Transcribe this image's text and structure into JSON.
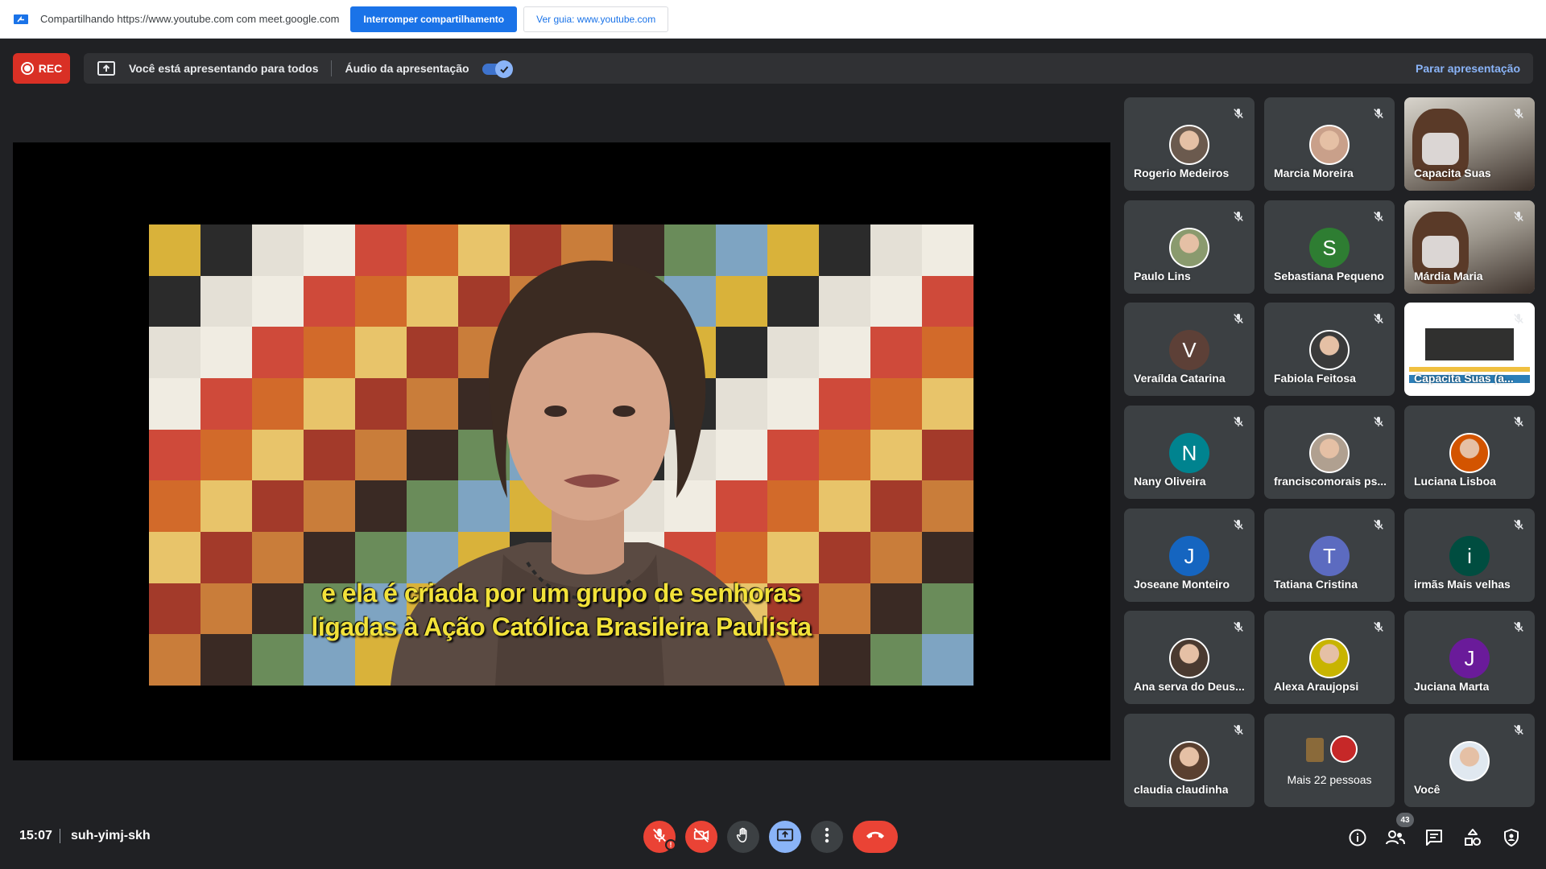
{
  "share_bar": {
    "text": "Compartilhando https://www.youtube.com com meet.google.com",
    "stop_label": "Interromper compartilhamento",
    "view_label": "Ver guia: www.youtube.com"
  },
  "rec": {
    "label": "REC"
  },
  "presenting": {
    "status": "Você está apresentando para todos",
    "audio_label": "Áudio da apresentação",
    "audio_enabled": true,
    "stop_label": "Parar apresentação"
  },
  "video": {
    "caption_line1": "e ela é criada por um grupo de senhoras",
    "caption_line2": "ligadas à Ação Católica Brasileira Paulista"
  },
  "participants": [
    {
      "name": "Rogerio Medeiros",
      "type": "photo",
      "color": "#6b5a4e"
    },
    {
      "name": "Marcia Moreira",
      "type": "photo",
      "color": "#c9a08a"
    },
    {
      "name": "Capacita Suas",
      "type": "video"
    },
    {
      "name": "Paulo Lins",
      "type": "photo",
      "color": "#8a9a6e"
    },
    {
      "name": "Sebastiana Pequeno",
      "type": "initial",
      "initial": "S",
      "color": "#2e7d32"
    },
    {
      "name": "Márdia Maria",
      "type": "video"
    },
    {
      "name": "Veraílda Catarina",
      "type": "initial",
      "initial": "V",
      "color": "#5d4037"
    },
    {
      "name": "Fabiola Feitosa",
      "type": "photo",
      "color": "#3a3a3a"
    },
    {
      "name": "Capacita Suas (a...",
      "type": "screen"
    },
    {
      "name": "Nany Oliveira",
      "type": "initial",
      "initial": "N",
      "color": "#00838f"
    },
    {
      "name": "franciscomorais ps...",
      "type": "photo",
      "color": "#b0a090"
    },
    {
      "name": "Luciana Lisboa",
      "type": "photo",
      "color": "#d35400"
    },
    {
      "name": "Joseane Monteiro",
      "type": "initial",
      "initial": "J",
      "color": "#1565c0"
    },
    {
      "name": "Tatiana Cristina",
      "type": "initial",
      "initial": "T",
      "color": "#5c6bc0"
    },
    {
      "name": "irmãs Mais velhas",
      "type": "initial",
      "initial": "i",
      "color": "#004d40"
    },
    {
      "name": "Ana serva do Deus...",
      "type": "photo",
      "color": "#4a3a30"
    },
    {
      "name": "Alexa Araujopsi",
      "type": "photo",
      "color": "#c8b400"
    },
    {
      "name": "Juciana Marta",
      "type": "initial",
      "initial": "J",
      "color": "#6a1b9a"
    },
    {
      "name": "claudia claudinha",
      "type": "photo",
      "color": "#5a4030"
    },
    {
      "name": "Mais 22 pessoas",
      "type": "more"
    },
    {
      "name": "Você",
      "type": "photo",
      "color": "#e0e8f0"
    }
  ],
  "meeting": {
    "time": "15:07",
    "code": "suh-yimj-skh",
    "participant_count": "43"
  },
  "icons": {
    "mic": "mic-off-icon",
    "camera": "camera-off-icon",
    "hand": "raise-hand-icon",
    "present": "present-icon",
    "more": "more-vert-icon",
    "end": "end-call-icon",
    "info": "info-icon",
    "people": "people-icon",
    "chat": "chat-icon",
    "activities": "activities-icon",
    "safety": "host-controls-icon"
  }
}
